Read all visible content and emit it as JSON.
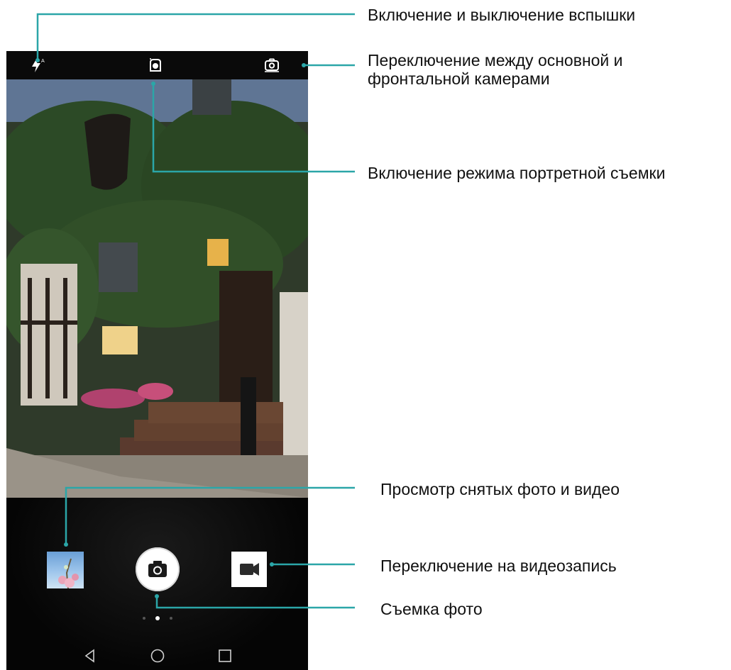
{
  "callouts": {
    "flash": "Включение и выключение вспышки",
    "switch_camera": "Переключение между основной и фронтальной камерами",
    "portrait_mode": "Включение режима портретной съемки",
    "gallery": "Просмотр снятых фото и видео",
    "video": "Переключение на видеозапись",
    "shutter": "Съемка фото"
  },
  "icons": {
    "flash": "flash-auto-icon",
    "portrait": "portrait-mode-icon",
    "switch": "switch-camera-icon",
    "shutter": "camera-icon",
    "video": "video-camera-icon",
    "nav_back": "back-triangle-icon",
    "nav_home": "home-circle-icon",
    "nav_recent": "recent-square-icon"
  },
  "mode_dots": {
    "count": 3,
    "active_index": 1
  },
  "colors": {
    "callout_line": "#2ba6a8",
    "screen_bg": "#000000",
    "label_text": "#111111"
  }
}
